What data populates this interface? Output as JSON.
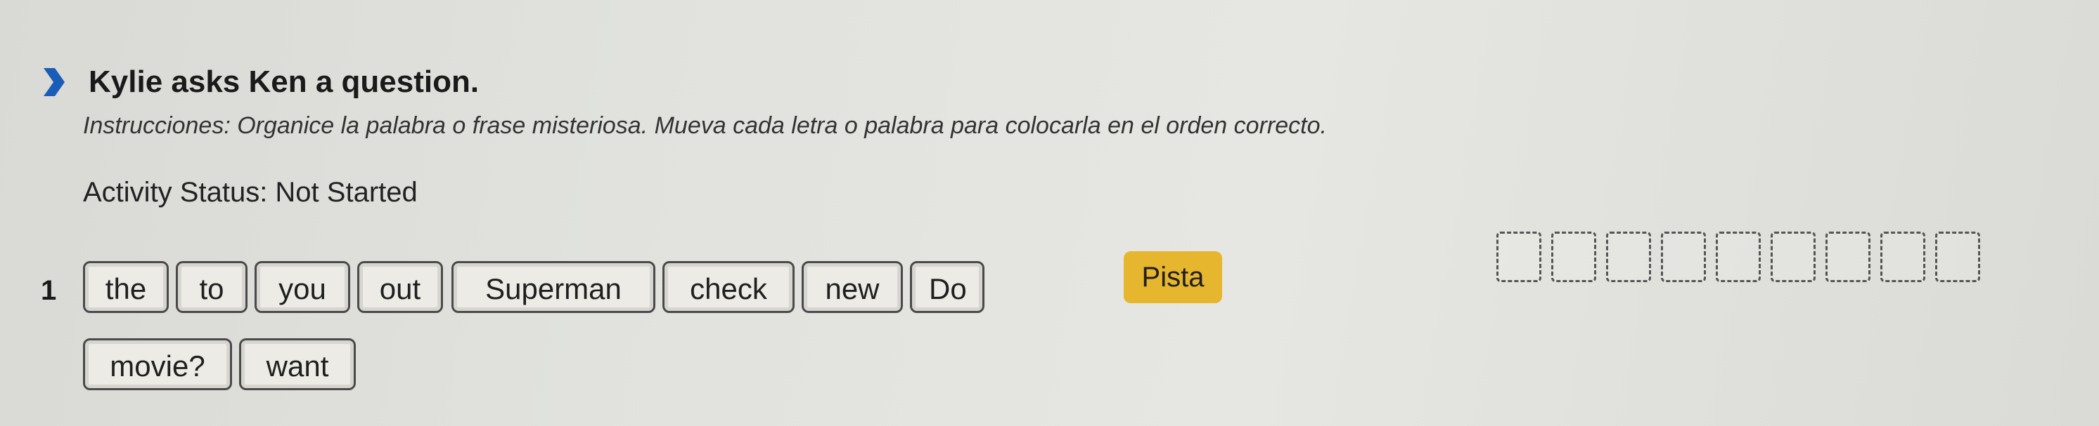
{
  "prompt": {
    "text": "Kylie asks Ken a question."
  },
  "instructions": "Instrucciones: Organice la palabra o frase misteriosa. Mueva cada letra o palabra para colocarla en el orden correcto.",
  "status": "Activity Status: Not Started",
  "item_number": "1",
  "word_tiles": [
    "the",
    "to",
    "you",
    "out",
    "Superman",
    "check",
    "new",
    "Do",
    "movie?",
    "want"
  ],
  "hint_label": "Pista",
  "answer_slot_count": 9,
  "colors": {
    "chevron": "#1a5db8",
    "hint_button": "#e7b62f",
    "tile_border": "#4a4a4a"
  },
  "icons": {
    "chevron": "chevron-right-icon"
  }
}
